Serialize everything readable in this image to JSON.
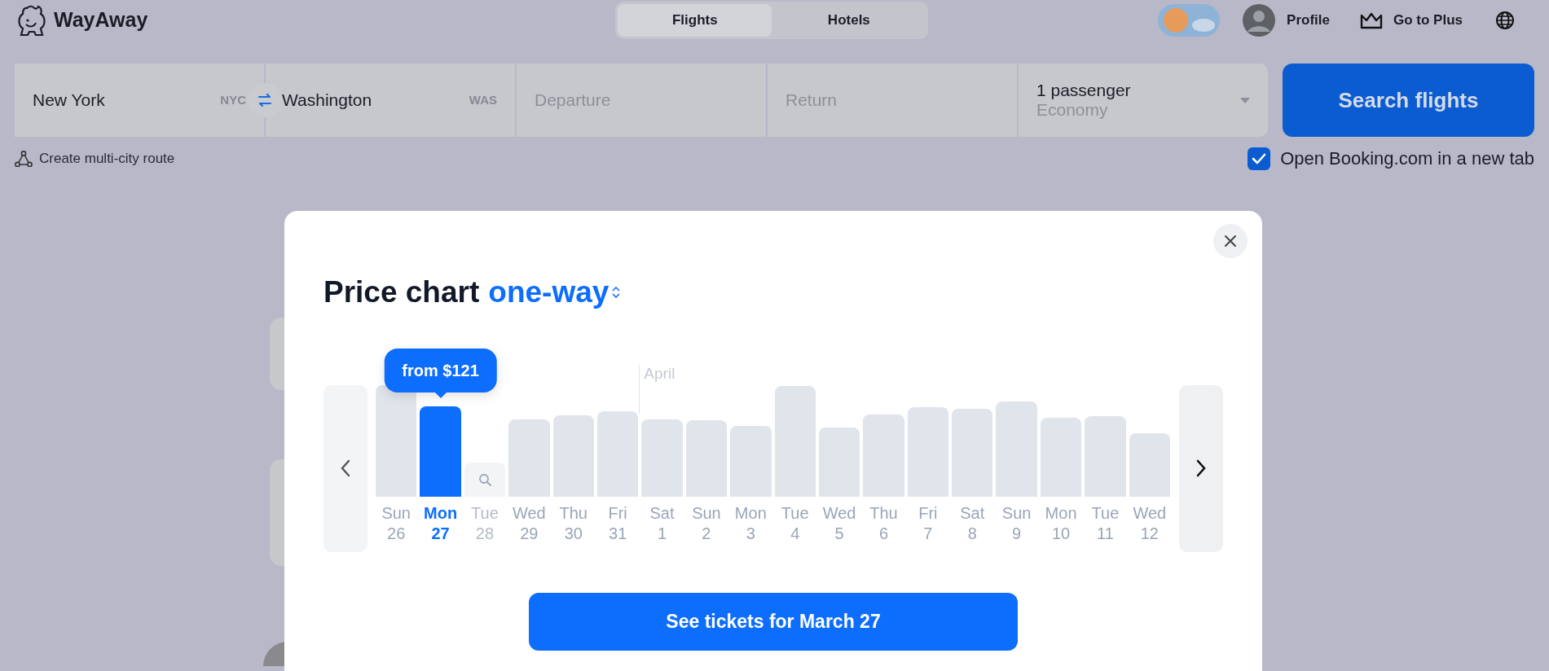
{
  "header": {
    "logo": "WayAway",
    "tabs": [
      {
        "label": "Flights",
        "selected": true
      },
      {
        "label": "Hotels",
        "selected": false
      }
    ],
    "profile": "Profile",
    "plus": "Go to Plus"
  },
  "search": {
    "origin": {
      "value": "New York",
      "code": "NYC"
    },
    "destination": {
      "value": "Washington",
      "code": "WAS"
    },
    "departure": {
      "placeholder": "Departure"
    },
    "return": {
      "placeholder": "Return"
    },
    "passengers": {
      "value": "1 passenger",
      "cabin": "Economy"
    },
    "button": "Search flights"
  },
  "multi_city": "Create multi-city route",
  "open_booking": {
    "label": "Open Booking.com in a new tab",
    "checked": true
  },
  "modal": {
    "title": "Price chart",
    "mode": "one-way",
    "tooltip": "from $121",
    "button": "See tickets for March 27",
    "days": [
      {
        "day": "Sun",
        "date": "26",
        "kind": "price",
        "selected": false
      },
      {
        "day": "Mon",
        "date": "27",
        "kind": "price",
        "selected": true
      },
      {
        "day": "Tue",
        "date": "28",
        "kind": "empty",
        "selected": false
      },
      {
        "day": "Wed",
        "date": "29",
        "kind": "price",
        "selected": false
      },
      {
        "day": "Thu",
        "date": "30",
        "kind": "price",
        "selected": false
      },
      {
        "day": "Fri",
        "date": "31",
        "kind": "price",
        "selected": false
      },
      {
        "day": "Sat",
        "date": "1",
        "kind": "price",
        "selected": false,
        "month": "April"
      },
      {
        "day": "Sun",
        "date": "2",
        "kind": "price",
        "selected": false
      },
      {
        "day": "Mon",
        "date": "3",
        "kind": "price",
        "selected": false
      },
      {
        "day": "Tue",
        "date": "4",
        "kind": "price",
        "selected": false
      },
      {
        "day": "Wed",
        "date": "5",
        "kind": "price",
        "selected": false
      },
      {
        "day": "Thu",
        "date": "6",
        "kind": "price",
        "selected": false
      },
      {
        "day": "Fri",
        "date": "7",
        "kind": "price",
        "selected": false
      },
      {
        "day": "Sat",
        "date": "8",
        "kind": "price",
        "selected": false
      },
      {
        "day": "Sun",
        "date": "9",
        "kind": "price",
        "selected": false
      },
      {
        "day": "Mon",
        "date": "10",
        "kind": "price",
        "selected": false
      },
      {
        "day": "Tue",
        "date": "11",
        "kind": "price",
        "selected": false
      },
      {
        "day": "Wed",
        "date": "12",
        "kind": "price",
        "selected": false
      }
    ]
  }
}
